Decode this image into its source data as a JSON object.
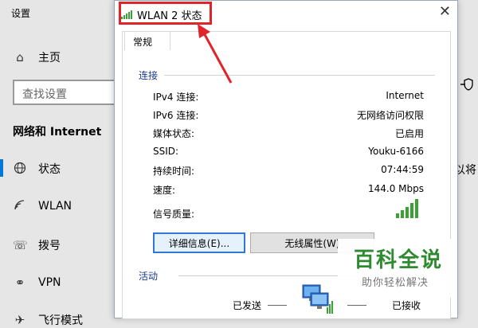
{
  "settings": {
    "title": "设置",
    "home_label": "主页",
    "search_placeholder": "查找设置",
    "section_heading": "网络和 Internet",
    "nav_items": [
      {
        "label": "状态",
        "icon": "globe-icon"
      },
      {
        "label": "WLAN",
        "icon": "wifi-icon"
      },
      {
        "label": "拨号",
        "icon": "dialup-icon"
      },
      {
        "label": "VPN",
        "icon": "vpn-icon"
      },
      {
        "label": "飞行模式",
        "icon": "airplane-icon"
      }
    ],
    "right_fragment": "以将"
  },
  "dialog": {
    "title": "WLAN 2 状态",
    "close_label": "✕",
    "tab_label": "常规",
    "connection": {
      "group_label": "连接",
      "rows": [
        {
          "key": "IPv4 连接:",
          "value": "Internet"
        },
        {
          "key": "IPv6 连接:",
          "value": "无网络访问权限"
        },
        {
          "key": "媒体状态:",
          "value": "已启用"
        },
        {
          "key": "SSID:",
          "value": "Youku-6166"
        },
        {
          "key": "持续时间:",
          "value": "07:44:59"
        },
        {
          "key": "速度:",
          "value": "144.0 Mbps"
        }
      ],
      "signal_label": "信号质量:",
      "signal_level": 5
    },
    "buttons": {
      "details": "详细信息(E)...",
      "wireless_props": "无线属性(W)"
    },
    "activity": {
      "group_label": "活动",
      "sent_label": "已发送",
      "received_label": "已接收"
    }
  },
  "watermark": {
    "main": "百科全说",
    "sub": "助你轻松解决"
  },
  "colors": {
    "highlight": "#e0242a",
    "signal": "#3aa234",
    "primary_border": "#2f79d6"
  }
}
